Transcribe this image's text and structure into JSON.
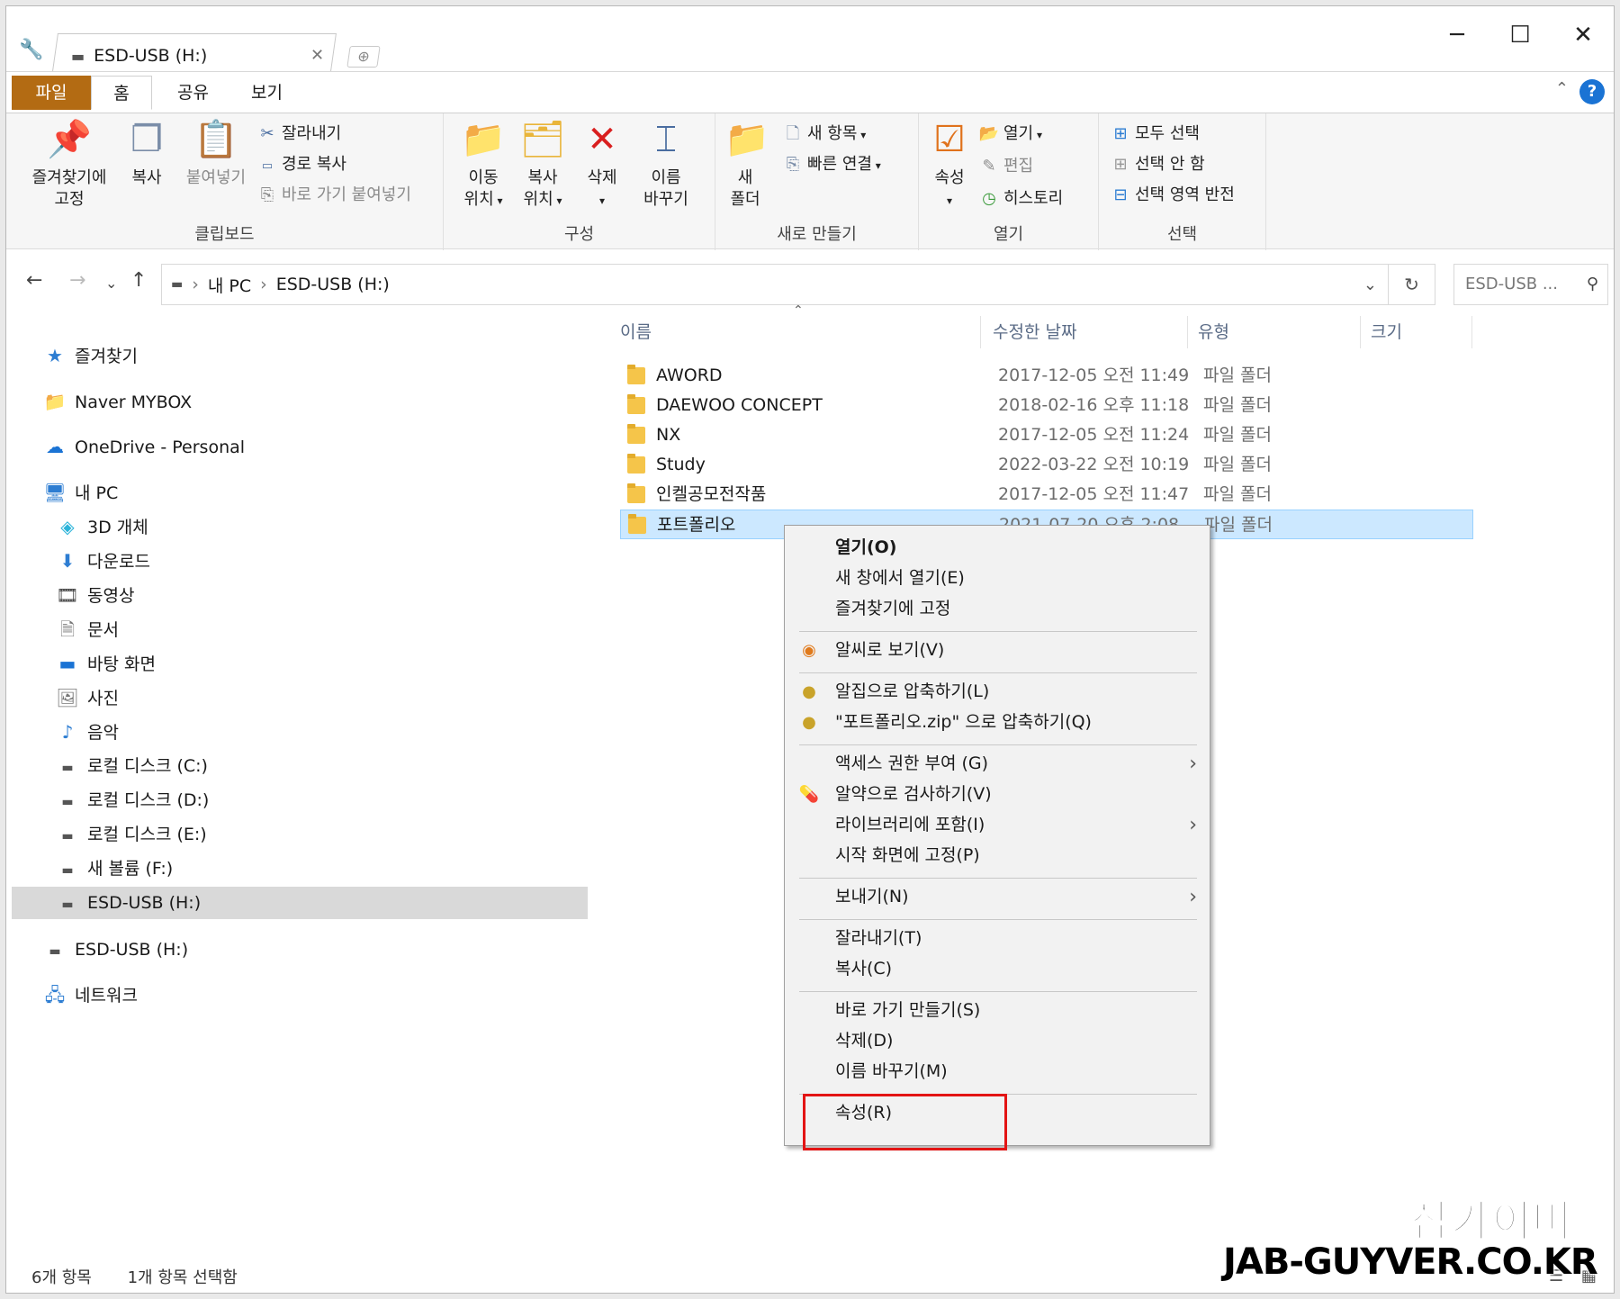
{
  "window": {
    "tab_title": "ESD-USB (H:)"
  },
  "ribbon_tabs": [
    "파일",
    "홈",
    "공유",
    "보기"
  ],
  "ribbon": {
    "clipboard": {
      "label": "클립보드",
      "pin": "즐겨찾기에 고정",
      "copy": "복사",
      "paste": "붙여넣기",
      "cut": "잘라내기",
      "copy_path": "경로 복사",
      "paste_shortcut": "바로 가기 붙여넣기"
    },
    "organize": {
      "label": "구성",
      "move_to_1": "이동",
      "move_to_2": "위치",
      "copy_to_1": "복사",
      "copy_to_2": "위치",
      "delete": "삭제",
      "rename_1": "이름",
      "rename_2": "바꾸기"
    },
    "new": {
      "label": "새로 만들기",
      "new_folder_1": "새",
      "new_folder_2": "폴더",
      "new_item": "새 항목",
      "easy_access": "빠른 연결"
    },
    "open": {
      "label": "열기",
      "properties": "속성",
      "open": "열기",
      "edit": "편집",
      "history": "히스토리"
    },
    "select": {
      "label": "선택",
      "select_all": "모두 선택",
      "select_none": "선택 안 함",
      "invert": "선택 영역 반전"
    }
  },
  "address": {
    "crumbs": [
      "내 PC",
      "ESD-USB (H:)"
    ],
    "search_placeholder": "ESD-USB ..."
  },
  "nav": {
    "favorites": "즐겨찾기",
    "mybox": "Naver MYBOX",
    "onedrive": "OneDrive - Personal",
    "thispc": "내 PC",
    "objects3d": "3D 개체",
    "downloads": "다운로드",
    "videos": "동영상",
    "documents": "문서",
    "desktop": "바탕 화면",
    "pictures": "사진",
    "music": "음악",
    "disk_c": "로컬 디스크 (C:)",
    "disk_d": "로컬 디스크 (D:)",
    "disk_e": "로컬 디스크 (E:)",
    "disk_f": "새 볼륨 (F:)",
    "disk_h": "ESD-USB (H:)",
    "usb": "ESD-USB (H:)",
    "network": "네트워크"
  },
  "columns": {
    "name": "이름",
    "date": "수정한 날짜",
    "type": "유형",
    "size": "크기"
  },
  "files": [
    {
      "name": "AWORD",
      "date": "2017-12-05 오전 11:49",
      "type": "파일 폴더"
    },
    {
      "name": "DAEWOO CONCEPT",
      "date": "2018-02-16 오후 11:18",
      "type": "파일 폴더"
    },
    {
      "name": "NX",
      "date": "2017-12-05 오전 11:24",
      "type": "파일 폴더"
    },
    {
      "name": "Study",
      "date": "2022-03-22 오전 10:19",
      "type": "파일 폴더"
    },
    {
      "name": "인켈공모전작품",
      "date": "2017-12-05 오전 11:47",
      "type": "파일 폴더"
    },
    {
      "name": "포트폴리오",
      "date": "2021-07-20 오후 2:08",
      "type": "파일 폴더"
    }
  ],
  "context_menu": {
    "open": "열기(O)",
    "open_new_window": "새 창에서 열기(E)",
    "pin_quick": "즐겨찾기에 고정",
    "alsee": "알씨로 보기(V)",
    "alzip": "알집으로 압축하기(L)",
    "alzip_named": "\"포트폴리오.zip\" 으로 압축하기(Q)",
    "give_access": "액세스 권한 부여 (G)",
    "alyac": "알약으로 검사하기(V)",
    "include_library": "라이브러리에 포함(I)",
    "pin_start": "시작 화면에 고정(P)",
    "send_to": "보내기(N)",
    "cut": "잘라내기(T)",
    "copy": "복사(C)",
    "create_shortcut": "바로 가기 만들기(S)",
    "delete": "삭제(D)",
    "rename": "이름 바꾸기(M)",
    "properties": "속성(R)"
  },
  "status": {
    "items": "6개 항목",
    "selected": "1개 항목 선택함"
  },
  "watermark": {
    "line1": "잡가이버",
    "line2": "JAB-GUYVER.CO.KR"
  },
  "colors": {
    "file_tab": "#b36b13",
    "selection": "#cce8ff",
    "highlight": "#e31414"
  }
}
